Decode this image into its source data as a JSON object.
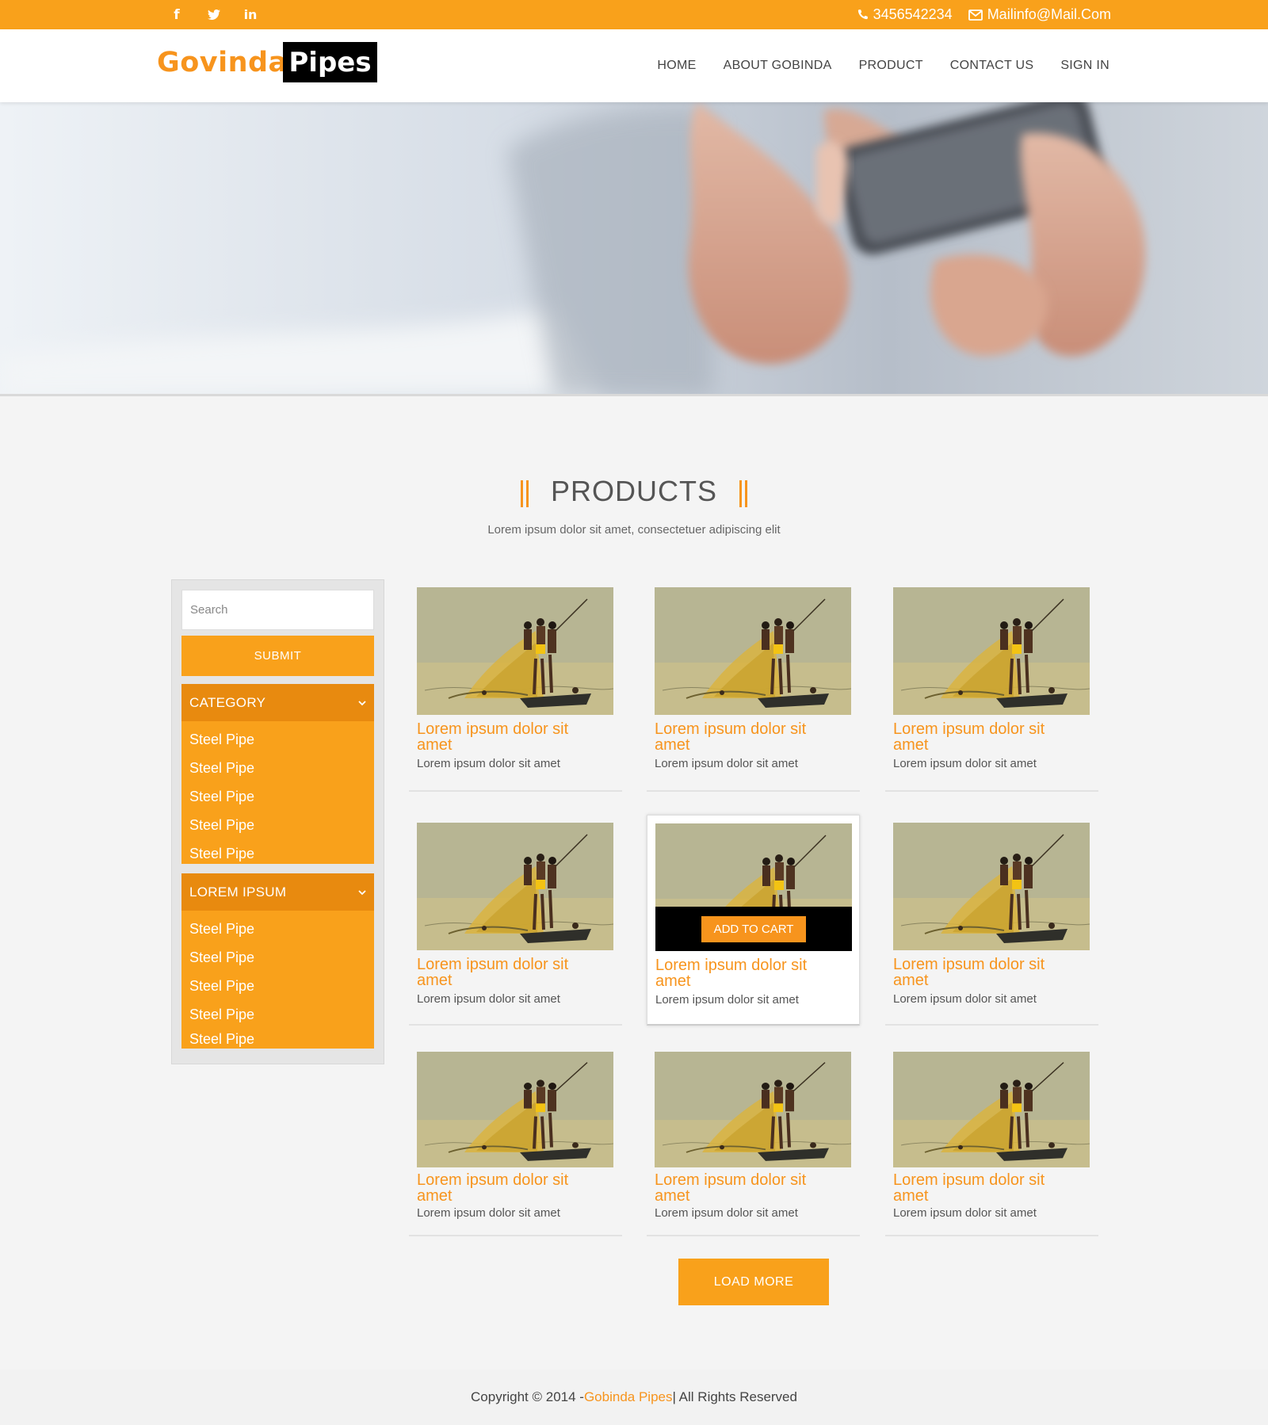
{
  "topbar": {
    "social": [
      "facebook-icon",
      "twitter-icon",
      "linkedin-icon"
    ],
    "facebook_glyph": "f",
    "twitter_glyph": "🐦",
    "linkedin_glyph": "in",
    "phone": "3456542234",
    "email": "Mailinfo@Mail.Com"
  },
  "header": {
    "logo_part1": "Govinda",
    "logo_part2": "Pipes",
    "nav": [
      "HOME",
      "ABOUT GOBINDA",
      "PRODUCT",
      "CONTACT US",
      "SIGN IN"
    ]
  },
  "section": {
    "title": "PRODUCTS",
    "subtitle": "Lorem ipsum dolor sit amet, consectetuer adipiscing elit"
  },
  "sidebar": {
    "search_placeholder": "Search",
    "submit_label": "SUBMIT",
    "categories": [
      {
        "title": "CATEGORY",
        "items": [
          "Steel Pipe",
          "Steel Pipe",
          "Steel Pipe",
          "Steel Pipe",
          "Steel Pipe"
        ]
      },
      {
        "title": "LOREM IPSUM",
        "items": [
          "Steel Pipe",
          "Steel Pipe",
          "Steel Pipe",
          "Steel Pipe",
          "Steel Pipe"
        ]
      }
    ]
  },
  "products": [
    {
      "title_line1": "Lorem ipsum dolor sit",
      "title_line2": "amet",
      "desc": "Lorem ipsum dolor sit amet"
    },
    {
      "title_line1": "Lorem ipsum dolor sit",
      "title_line2": "amet",
      "desc": "Lorem ipsum dolor sit amet"
    },
    {
      "title_line1": "Lorem ipsum dolor sit",
      "title_line2": "amet",
      "desc": "Lorem ipsum dolor sit amet"
    },
    {
      "title_line1": "Lorem ipsum dolor sit",
      "title_line2": "amet",
      "desc": "Lorem ipsum dolor sit amet"
    },
    {
      "title_line1": "Lorem ipsum dolor sit",
      "title_line2": "amet",
      "desc": "Lorem ipsum dolor sit amet",
      "cart_label": "ADD TO CART"
    },
    {
      "title_line1": "Lorem ipsum dolor sit",
      "title_line2": "amet",
      "desc": "Lorem ipsum dolor sit amet"
    },
    {
      "title_line1": "Lorem ipsum dolor sit",
      "title_line2": "amet",
      "desc": "Lorem ipsum dolor sit amet"
    },
    {
      "title_line1": "Lorem ipsum dolor sit",
      "title_line2": "amet",
      "desc": "Lorem ipsum dolor sit amet"
    },
    {
      "title_line1": "Lorem ipsum dolor sit",
      "title_line2": "amet",
      "desc": "Lorem ipsum dolor sit amet"
    }
  ],
  "load_more_label": "LOAD MORE",
  "footer": {
    "prefix": "Copyright © 2014 - ",
    "brand": "Gobinda Pipes",
    "suffix": " | All Rights Reserved"
  },
  "colors": {
    "accent": "#f9a11b",
    "accent_dark": "#e88a0f",
    "text": "#555555"
  }
}
